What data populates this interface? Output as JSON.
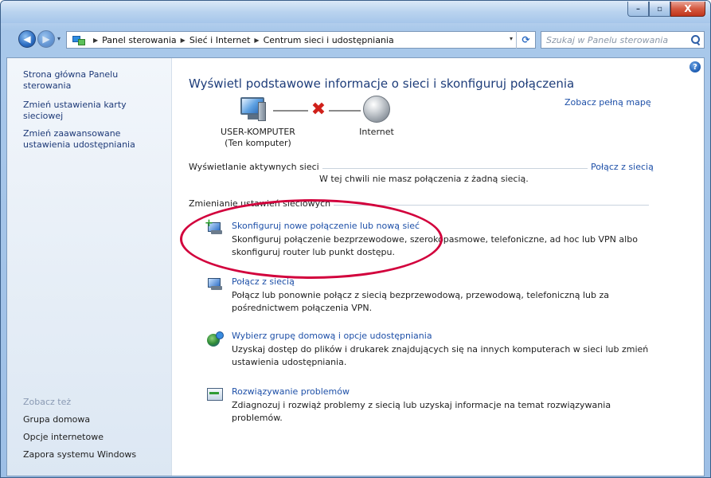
{
  "window": {
    "minimize_glyph": "–",
    "maximize_glyph": "▫",
    "close_glyph": "X"
  },
  "nav": {
    "back_glyph": "◀",
    "forward_glyph": "▶"
  },
  "address": {
    "crumbs": [
      "Panel sterowania",
      "Sieć i Internet",
      "Centrum sieci i udostępniania"
    ],
    "separator": "▶",
    "dropdown_glyph": "▾",
    "refresh_glyph": "⟳"
  },
  "search": {
    "placeholder": "Szukaj w Panelu sterowania"
  },
  "sidebar": {
    "links": [
      "Strona główna Panelu sterowania",
      "Zmień ustawienia karty sieciowej",
      "Zmień zaawansowane ustawienia udostępniania"
    ],
    "see_also_label": "Zobacz też",
    "see_also": [
      "Grupa domowa",
      "Opcje internetowe",
      "Zapora systemu Windows"
    ]
  },
  "main": {
    "help_glyph": "?",
    "title": "Wyświetl podstawowe informacje o sieci i skonfiguruj połączenia",
    "full_map_link": "Zobacz pełną mapę",
    "computer_name": "USER-KOMPUTER",
    "computer_sub": "(Ten komputer)",
    "internet_label": "Internet",
    "disconnected_glyph": "✖",
    "active_networks_heading": "Wyświetlanie aktywnych sieci",
    "connect_link": "Połącz z siecią",
    "no_connection_text": "W tej chwili nie masz połączenia z żadną siecią.",
    "change_settings_heading": "Zmienianie ustawień sieciowych",
    "tasks": [
      {
        "title": "Skonfiguruj nowe połączenie lub nową sieć",
        "desc": "Skonfiguruj połączenie bezprzewodowe, szerokopasmowe, telefoniczne, ad hoc lub VPN albo skonfiguruj router lub punkt dostępu."
      },
      {
        "title": "Połącz z siecią",
        "desc": "Połącz lub ponownie połącz z siecią bezprzewodową, przewodową, telefoniczną lub za pośrednictwem połączenia VPN."
      },
      {
        "title": "Wybierz grupę domową i opcje udostępniania",
        "desc": "Uzyskaj dostęp do plików i drukarek znajdujących się na innych komputerach w sieci lub zmień ustawienia udostępniania."
      },
      {
        "title": "Rozwiązywanie problemów",
        "desc": "Zdiagnozuj i rozwiąż problemy z siecią lub uzyskaj informacje na temat rozwiązywania problemów."
      }
    ]
  }
}
